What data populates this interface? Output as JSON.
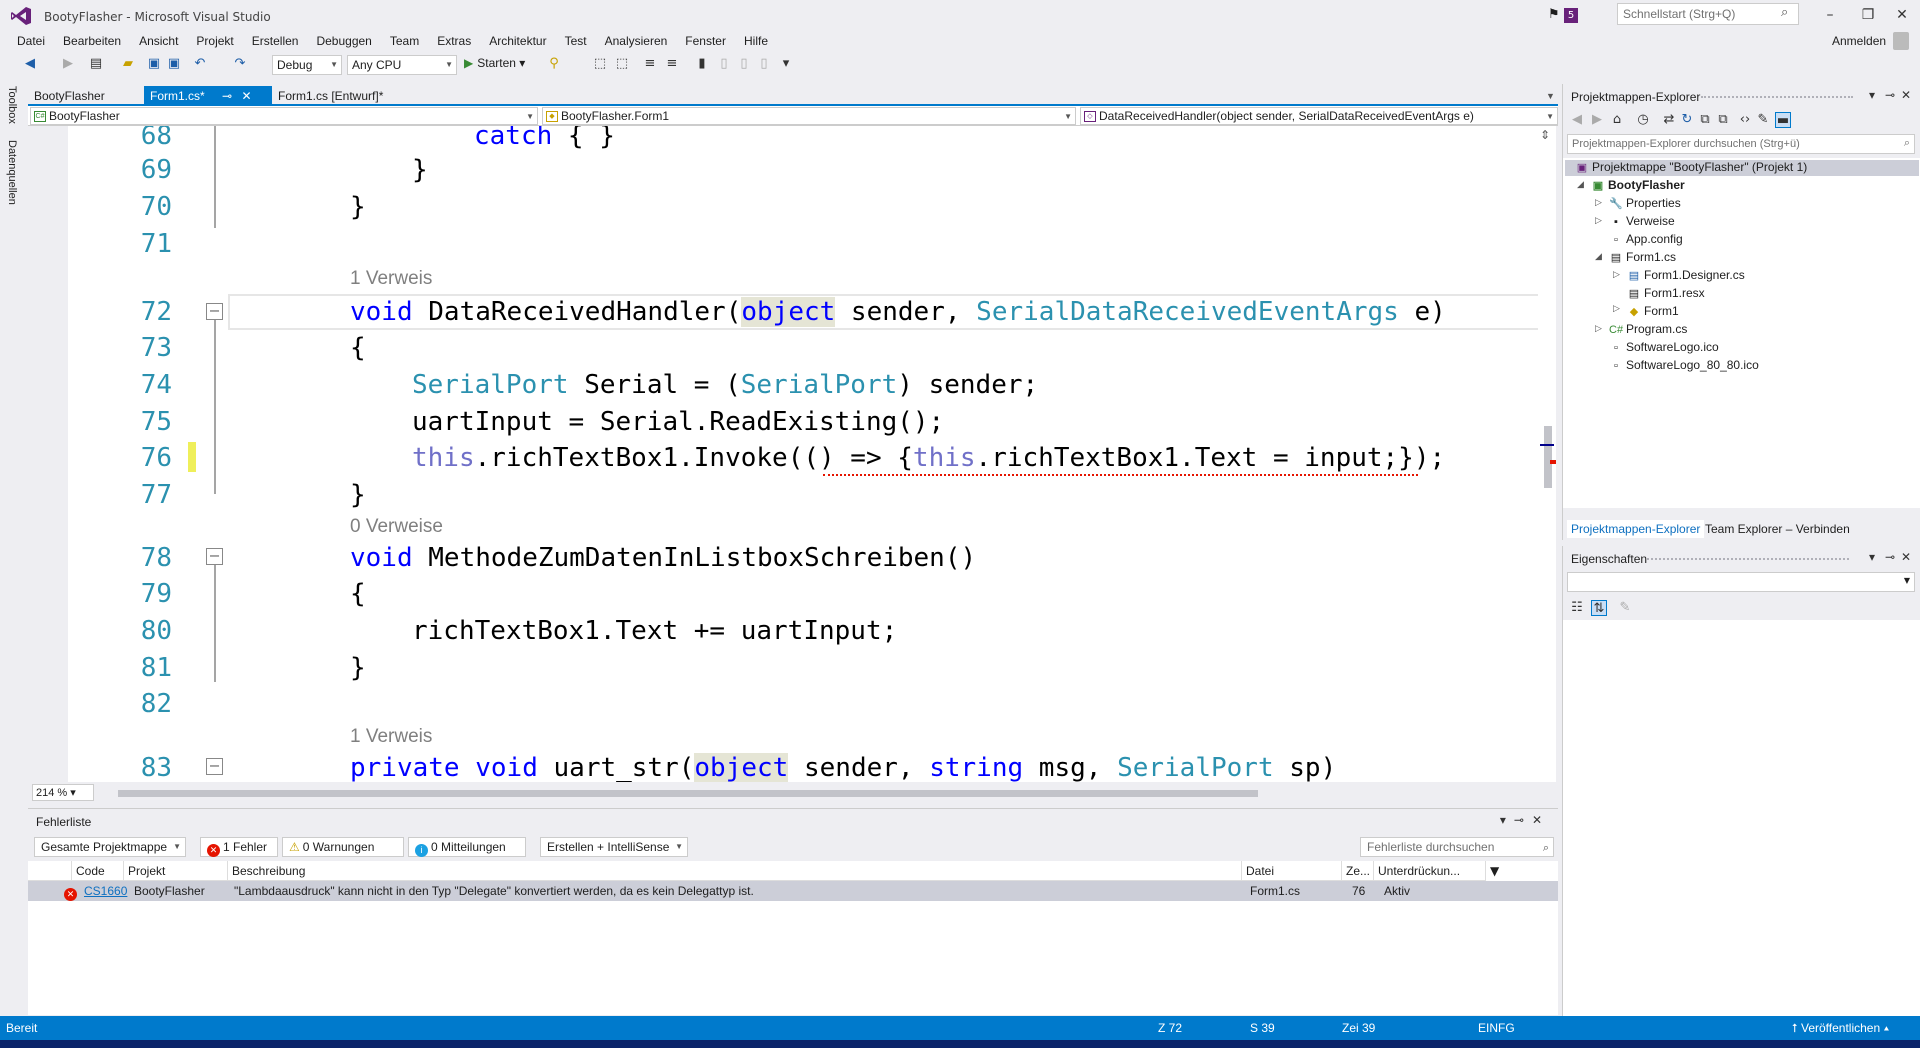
{
  "window": {
    "title": "BootyFlasher - Microsoft Visual Studio",
    "notification_count": "5",
    "quick_launch_placeholder": "Schnellstart (Strg+Q)",
    "sign_in": "Anmelden"
  },
  "menu": [
    "Datei",
    "Bearbeiten",
    "Ansicht",
    "Projekt",
    "Erstellen",
    "Debuggen",
    "Team",
    "Extras",
    "Architektur",
    "Test",
    "Analysieren",
    "Fenster",
    "Hilfe"
  ],
  "toolbar": {
    "configuration": "Debug",
    "platform": "Any CPU",
    "start_label": "Starten"
  },
  "left_strip": {
    "toolbox": "Toolbox",
    "datasources": "Datenquellen"
  },
  "tabs": [
    {
      "label": "BootyFlasher"
    },
    {
      "label": "Form1.cs*"
    },
    {
      "label": "Form1.cs [Entwurf]*"
    }
  ],
  "navbar": {
    "project": "BootyFlasher",
    "class": "BootyFlasher.Form1",
    "member": "DataReceivedHandler(object sender, SerialDataReceivedEventArgs e)"
  },
  "editor": {
    "refs": {
      "r1": "1 Verweis",
      "r2": "0 Verweise",
      "r3": "1 Verweis"
    },
    "lines": {
      "l68": "68",
      "l69": "69",
      "l70": "70",
      "l71": "71",
      "l72": "72",
      "l73": "73",
      "l74": "74",
      "l75": "75",
      "l76": "76",
      "l77": "77",
      "l78": "78",
      "l79": "79",
      "l80": "80",
      "l81": "81",
      "l82": "82",
      "l83": "83"
    },
    "zoom": "214 %"
  },
  "error_list": {
    "title": "Fehlerliste",
    "scope": "Gesamte Projektmappe",
    "errors": "1 Fehler",
    "warnings": "0 Warnungen",
    "messages": "0 Mitteilungen",
    "build_filter": "Erstellen + IntelliSense",
    "search_placeholder": "Fehlerliste durchsuchen",
    "columns": {
      "code": "Code",
      "project": "Projekt",
      "description": "Beschreibung",
      "file": "Datei",
      "line": "Ze...",
      "suppression": "Unterdrückun..."
    },
    "row": {
      "code": "CS1660",
      "project": "BootyFlasher",
      "description": "\"Lambdaausdruck\" kann nicht in den Typ \"Delegate\" konvertiert werden, da es kein Delegattyp ist.",
      "file": "Form1.cs",
      "line": "76",
      "suppression": "Aktiv"
    }
  },
  "solution_explorer": {
    "title": "Projektmappen-Explorer",
    "search_placeholder": "Projektmappen-Explorer durchsuchen (Strg+ü)",
    "items": {
      "solution": "Projektmappe \"BootyFlasher\" (Projekt 1)",
      "project": "BootyFlasher",
      "properties": "Properties",
      "references": "Verweise",
      "appconfig": "App.config",
      "form1cs": "Form1.cs",
      "designer": "Form1.Designer.cs",
      "resx": "Form1.resx",
      "form1": "Form1",
      "program": "Program.cs",
      "logo": "SoftwareLogo.ico",
      "logo80": "SoftwareLogo_80_80.ico"
    },
    "tab_active": "Projektmappen-Explorer",
    "tab_other": "Team Explorer – Verbinden"
  },
  "properties": {
    "title": "Eigenschaften"
  },
  "status": {
    "ready": "Bereit",
    "line": "Z 72",
    "col": "S 39",
    "char": "Zei 39",
    "mode": "EINFG",
    "publish": "Veröffentlichen"
  },
  "colors": {
    "accent": "#007acc",
    "keyword": "#0000ff",
    "type": "#2b91af",
    "error": "#e51400"
  }
}
